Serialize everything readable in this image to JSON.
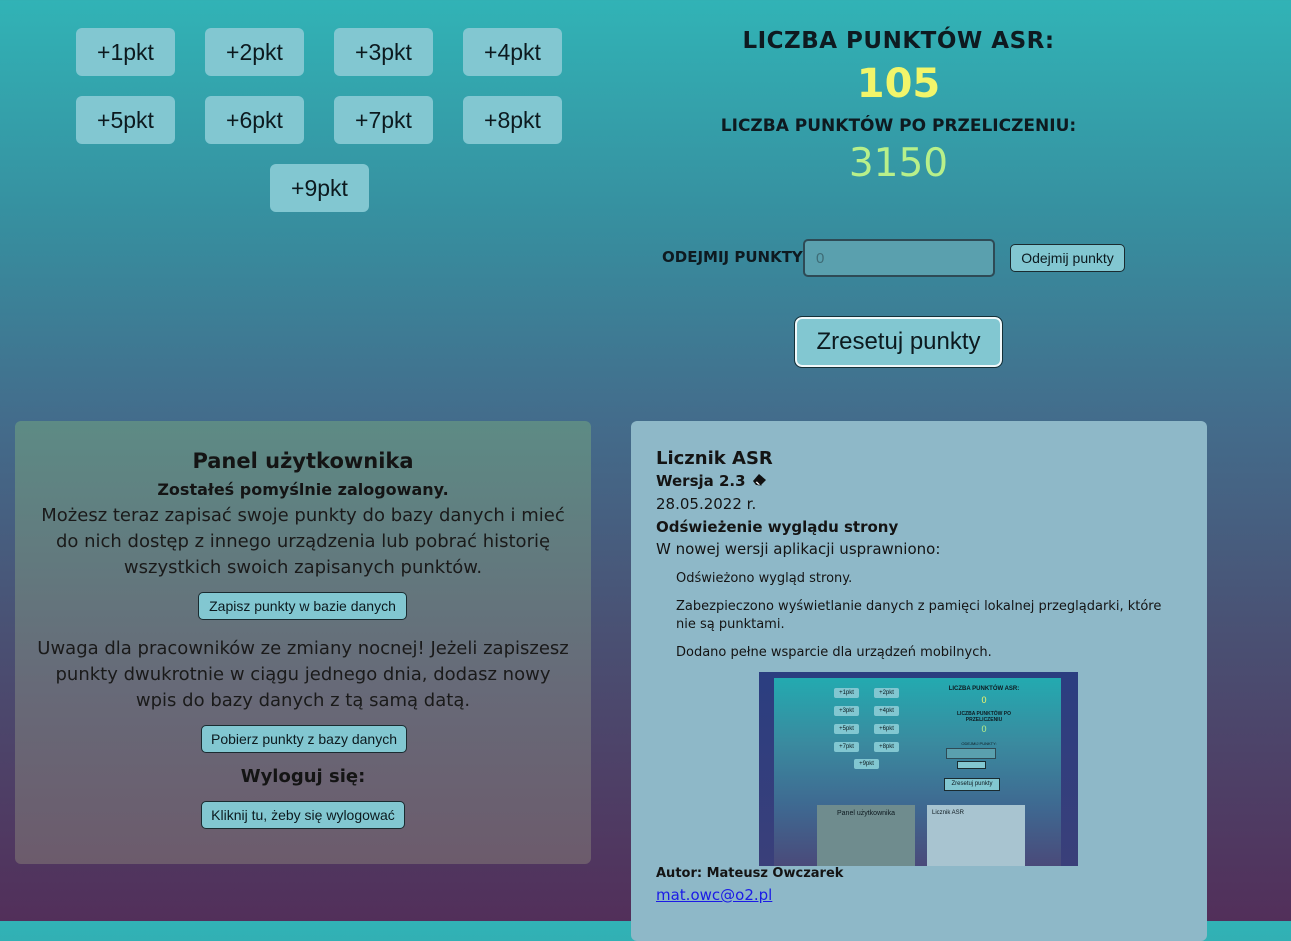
{
  "points_buttons": [
    "+1pkt",
    "+2pkt",
    "+3pkt",
    "+4pkt",
    "+5pkt",
    "+6pkt",
    "+7pkt",
    "+8pkt",
    "+9pkt"
  ],
  "counter": {
    "asr_title": "LICZBA PUNKTÓW ASR:",
    "asr_value": "105",
    "converted_title": "LICZBA PUNKTÓW PO PRZELICZENIU:",
    "converted_value": "3150",
    "subtract_label": "ODEJMIJ PUNKTY:",
    "subtract_placeholder": "0",
    "subtract_button": "Odejmij punkty",
    "reset_button": "Zresetuj punkty"
  },
  "user_panel": {
    "title": "Panel użytkownika",
    "subtitle": "Zostałeś pomyślnie zalogowany.",
    "text1": "Możesz teraz zapisać swoje punkty do bazy danych i mieć do nich dostęp z innego urządzenia lub pobrać historię wszystkich swoich zapisanych punktów.",
    "save_button": "Zapisz punkty w bazie danych",
    "text2": "Uwaga dla pracowników ze zmiany nocnej! Jeżeli zapiszesz punkty dwukrotnie w ciągu jednego dnia, dodasz nowy wpis do bazy danych z tą samą datą.",
    "load_button": "Pobierz punkty z bazy danych",
    "logout_title": "Wyloguj się:",
    "logout_button": "Kliknij tu, żeby się wylogować"
  },
  "info_panel": {
    "title": "Licznik ASR",
    "version": "Wersja 2.3",
    "date": "28.05.2022 r.",
    "heading": "Odświeżenie wyglądu strony",
    "intro": "W nowej wersji aplikacji usprawniono:",
    "items": [
      "Odświeżono wygląd strony.",
      "Zabezpieczono wyświetlanie danych z pamięci lokalnej przeglądarki, które nie są punktami.",
      "Dodano pełne wsparcie dla urządzeń mobilnych."
    ],
    "author": "Autor: Mateusz Owczarek",
    "email": "mat.owc@o2.pl"
  },
  "preview": {
    "buttons": [
      "+1pkt",
      "+2pkt",
      "+3pkt",
      "+4pkt",
      "+5pkt",
      "+6pkt",
      "+7pkt",
      "+8pkt",
      "+9pkt"
    ],
    "asr_title": "LICZBA PUNKTÓW ASR:",
    "asr_value": "0",
    "converted_title": "LICZBA PUNKTÓW PO PRZELICZENIU",
    "converted_value": "0",
    "subtract_label": "ODEJMIJ PUNKTY:",
    "reset_button": "Zresetuj punkty",
    "panel_title": "Panel użytkownika",
    "info_title": "Licznik ASR"
  },
  "icons": {
    "version_icon": "eraser-icon"
  }
}
